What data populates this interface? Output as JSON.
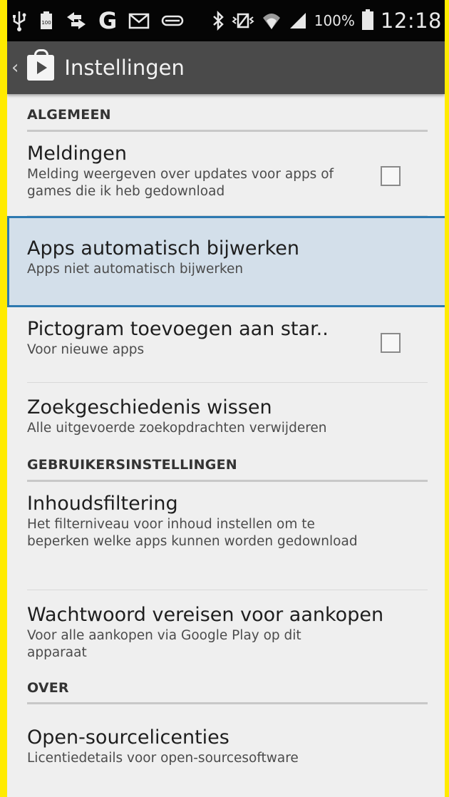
{
  "status_bar": {
    "battery_text": "100%",
    "time": "12:18",
    "icons": [
      "usb-icon",
      "battery-100-icon",
      "transfer-icon",
      "google-g-icon",
      "gmail-icon",
      "voicemail-icon",
      "bluetooth-icon",
      "vibrate-icon",
      "wifi-icon",
      "signal-icon",
      "battery-icon"
    ]
  },
  "action_bar": {
    "title": "Instellingen"
  },
  "sections": {
    "general": "ALGEMEEN",
    "user": "GEBRUIKERSINSTELLINGEN",
    "about": "OVER"
  },
  "items": {
    "notifications": {
      "title": "Meldingen",
      "subtitle": "Melding weergeven over updates voor apps of games die ik heb gedownload",
      "checked": false
    },
    "auto_update": {
      "title": "Apps automatisch bijwerken",
      "subtitle": "Apps niet automatisch bijwerken"
    },
    "add_icon": {
      "title": "Pictogram toevoegen aan star..",
      "subtitle": "Voor nieuwe apps",
      "checked": false
    },
    "clear_history": {
      "title": "Zoekgeschiedenis wissen",
      "subtitle": "Alle uitgevoerde zoekopdrachten verwijderen"
    },
    "content_filter": {
      "title": "Inhoudsfiltering",
      "subtitle": "Het filterniveau voor inhoud instellen om te beperken welke apps kunnen worden gedownload"
    },
    "password": {
      "title": "Wachtwoord vereisen voor aankopen",
      "subtitle": "Voor alle aankopen via Google Play op dit apparaat"
    },
    "licenses": {
      "title": "Open-sourcelicenties",
      "subtitle": "Licentiedetails voor open-sourcesoftware"
    }
  },
  "colors": {
    "frame_yellow": "#ffeb00",
    "highlight_bg": "#d3dfea",
    "highlight_border": "#2d79b0",
    "action_bar": "#4a4a4a"
  }
}
